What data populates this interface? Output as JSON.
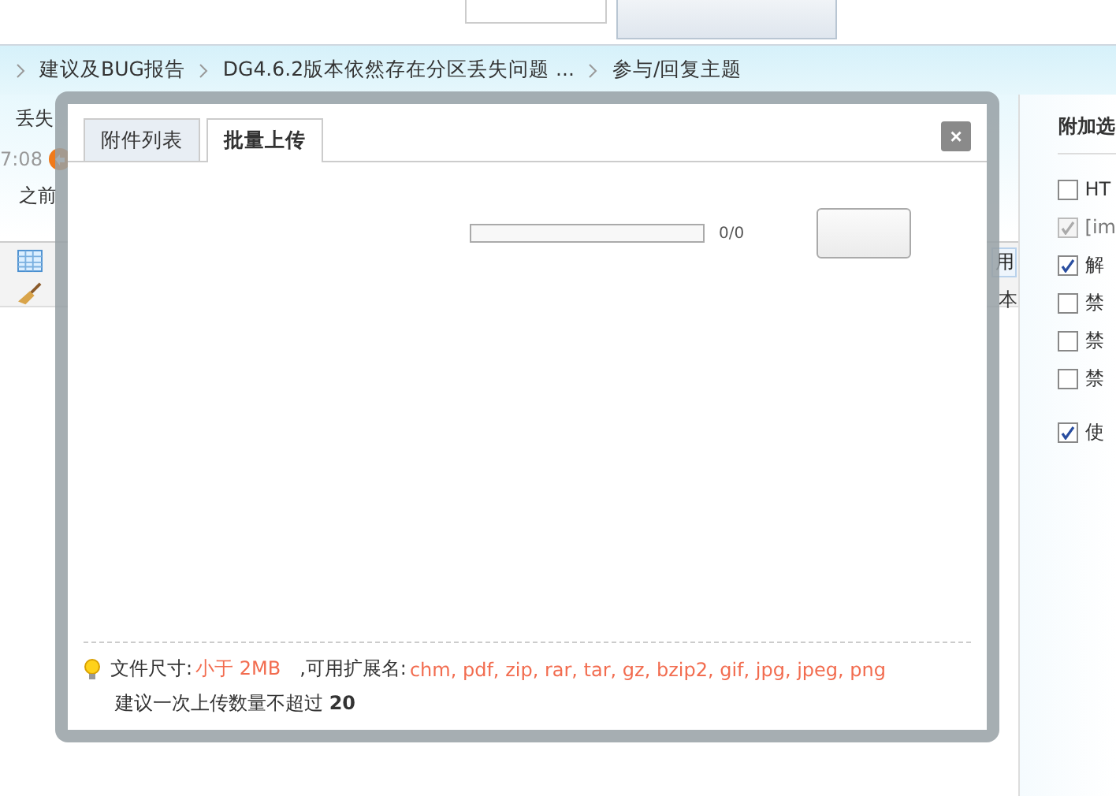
{
  "breadcrumb": [
    "建议及BUG报告",
    "DG4.6.2版本依然存在分区丢失问题 ...",
    "参与/回复主题"
  ],
  "post": {
    "title": "丢失",
    "time": "7:08",
    "excerpt": "之前"
  },
  "editor_toolbar": {
    "label_1": "用",
    "label_2": "本"
  },
  "options": {
    "title": "附加选",
    "items": [
      {
        "label": "HT",
        "checked": false,
        "disabled": false
      },
      {
        "label": "[im",
        "checked": true,
        "disabled": true
      },
      {
        "label": "解",
        "checked": true,
        "disabled": false
      },
      {
        "label": "禁",
        "checked": false,
        "disabled": false
      },
      {
        "label": "禁",
        "checked": false,
        "disabled": false
      },
      {
        "label": "禁",
        "checked": false,
        "disabled": false
      },
      {
        "label": "使",
        "checked": true,
        "disabled": false
      }
    ]
  },
  "dialog": {
    "tabs": [
      {
        "label": "附件列表",
        "selected": false
      },
      {
        "label": "批量上传",
        "selected": true
      }
    ],
    "close": "×",
    "progress": {
      "level": 0,
      "reading": "0/0"
    },
    "info": {
      "size_label": "文件尺寸:",
      "size_value": "小于 2MB",
      "ext_label": ",可用扩展名:",
      "ext_value": "chm, pdf, zip, rar, tar, gz, bzip2, gif, jpg, jpeg, png",
      "limit": "建议一次上传数量不超过 **20**"
    }
  }
}
